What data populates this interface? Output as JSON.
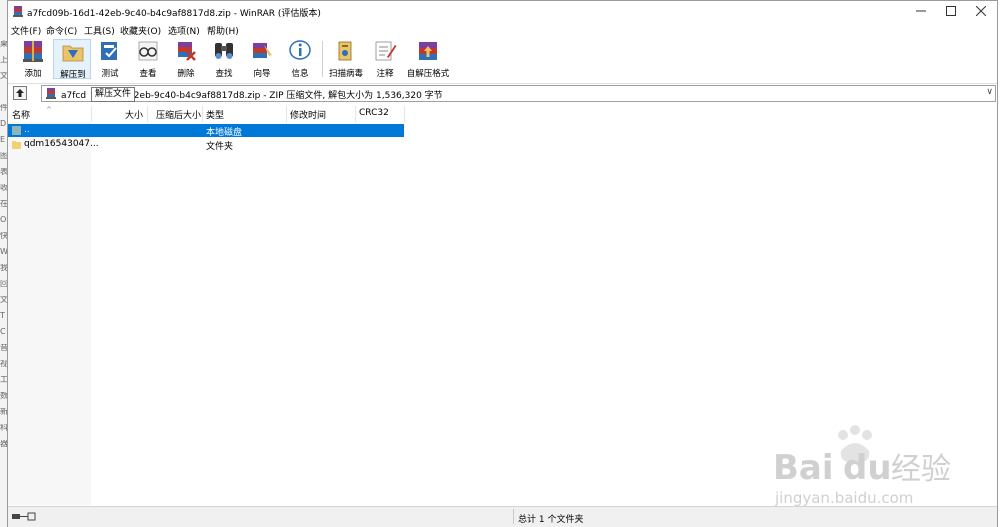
{
  "window": {
    "title": "a7fcd09b-16d1-42eb-9c40-b4c9af8817d8.zip - WinRAR (评估版本)"
  },
  "background_strip": [
    "桌",
    "上",
    "文",
    "件",
    "D",
    "E",
    "图",
    "表",
    "收",
    "在",
    "Or",
    "快",
    "W",
    "我",
    "回",
    "文",
    "T",
    "C",
    "音",
    "视",
    "工",
    "数",
    "新",
    "科",
    "器"
  ],
  "menu": [
    {
      "label": "文件(F)"
    },
    {
      "label": "命令(C)"
    },
    {
      "label": "工具(S)"
    },
    {
      "label": "收藏夹(O)"
    },
    {
      "label": "选项(N)"
    },
    {
      "label": "帮助(H)"
    }
  ],
  "toolbar": {
    "add": "添加",
    "extract": "解压到",
    "test": "测试",
    "view": "查看",
    "delete": "删除",
    "find": "查找",
    "wizard": "向导",
    "info": "信息",
    "scan": "扫描病毒",
    "comment": "注释",
    "sfx": "自解压格式"
  },
  "address": {
    "path_start": "a7fcd",
    "path_rest": "42eb-9c40-b4c9af8817d8.zip - ZIP 压缩文件, 解包大小为 1,536,320 字节",
    "tooltip": "解压文件"
  },
  "columns": {
    "name": "名称",
    "size": "大小",
    "packed": "压缩后大小",
    "type": "类型",
    "modified": "修改时间",
    "crc": "CRC32"
  },
  "files": [
    {
      "name": "..",
      "type": "本地磁盘",
      "selected": true
    },
    {
      "name": "qdm16543047...",
      "type": "文件夹",
      "selected": false
    }
  ],
  "status": {
    "summary": "总计 1 个文件夹"
  },
  "colors": {
    "selection": "#0078d7",
    "folder": "#f3d073",
    "title_bar": "#ffffff"
  },
  "watermark": {
    "brand": "Bai",
    "brand2": "du",
    "brand_cn": "经验",
    "url": "jingyan.baidu.com"
  }
}
